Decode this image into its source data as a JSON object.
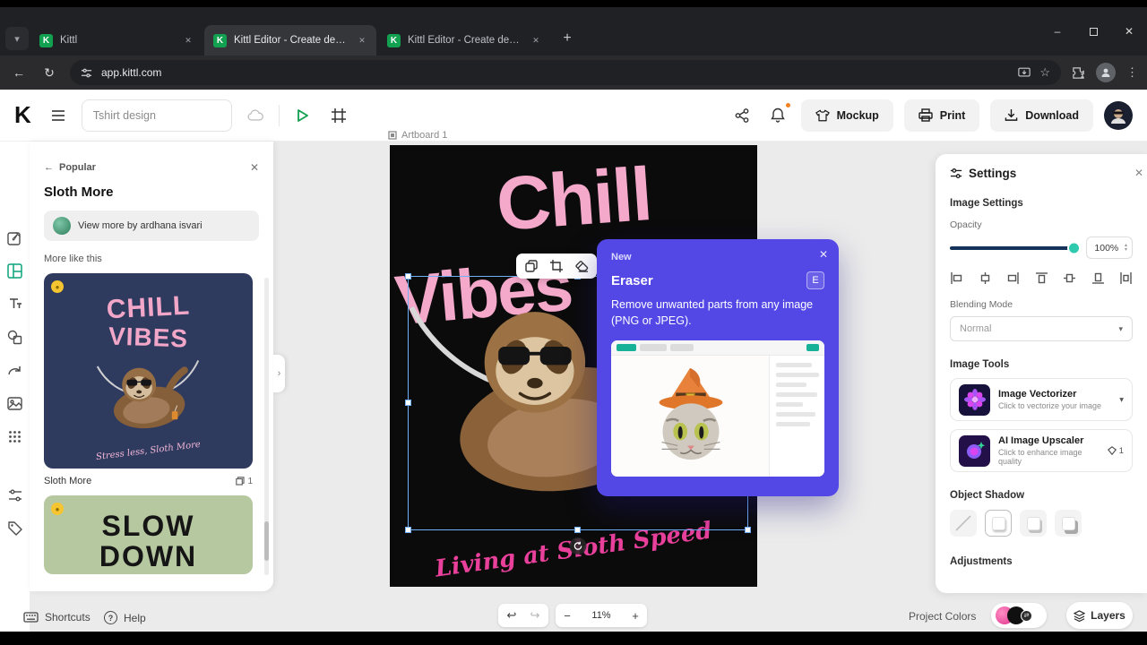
{
  "icons": {
    "close": "✕",
    "plus": "+",
    "minus": "−",
    "back_arrow": "←",
    "refresh": "↻",
    "kebab": "⋮",
    "star": "☆",
    "undo": "↩",
    "redo": "↪",
    "step_up": "▴",
    "step_down": "▾",
    "question": "?",
    "swap": "⇄",
    "minimize": "–",
    "chevron_right": "›",
    "chevron_down": "▾",
    "crown": "●"
  },
  "browser": {
    "favicon_letter": "K",
    "tabs": [
      {
        "label": "Kittl"
      },
      {
        "label": "Kittl Editor - Create designs tha"
      },
      {
        "label": "Kittl Editor - Create designs tha"
      }
    ],
    "url": "app.kittl.com"
  },
  "toolbar": {
    "logo": "K",
    "design_title": "Tshirt design",
    "mockup": "Mockup",
    "print": "Print",
    "download": "Download"
  },
  "left_panel": {
    "back": "Popular",
    "title": "Sloth More",
    "view_more": "View more by ardhana isvari",
    "section": "More like this",
    "card1": {
      "line1": "CHILL",
      "line2": "VIBES",
      "script": "Stress less, Sloth More",
      "caption": "Sloth More",
      "count": "1"
    },
    "card2": {
      "line1": "SLOW",
      "line2": "DOWN"
    }
  },
  "canvas": {
    "artboard": "Artboard 1",
    "title_line1": "Chill",
    "title_line2": "Vibes",
    "bottom_text": "Living at Sloth Speed"
  },
  "popup": {
    "badge": "New",
    "title": "Eraser",
    "shortcut": "E",
    "description": "Remove unwanted parts from any image (PNG or JPEG)."
  },
  "settings": {
    "title": "Settings",
    "image_settings": "Image Settings",
    "opacity": "Opacity",
    "opacity_value": "100%",
    "blending": "Blending Mode",
    "blending_value": "Normal",
    "image_tools": "Image Tools",
    "tool1": {
      "name": "Image Vectorizer",
      "desc": "Click to vectorize your image"
    },
    "tool2": {
      "name": "AI Image Upscaler",
      "desc": "Click to enhance image quality",
      "credit": "1"
    },
    "object_shadow": "Object Shadow",
    "adjustments": "Adjustments"
  },
  "bottom": {
    "shortcuts": "Shortcuts",
    "help": "Help",
    "zoom": "11%",
    "project_colors": "Project Colors",
    "layers": "Layers"
  },
  "colors": {
    "popup_purple": "#5348e6",
    "accent_teal": "#2fc9ae",
    "brand_green": "#12a150",
    "design_pink": "#f4a9cb",
    "script_magenta": "#e8409b",
    "notification_orange": "#f4801f",
    "thumb_navy": "#2e3a5e",
    "thumb_sage": "#b6c8a0"
  }
}
